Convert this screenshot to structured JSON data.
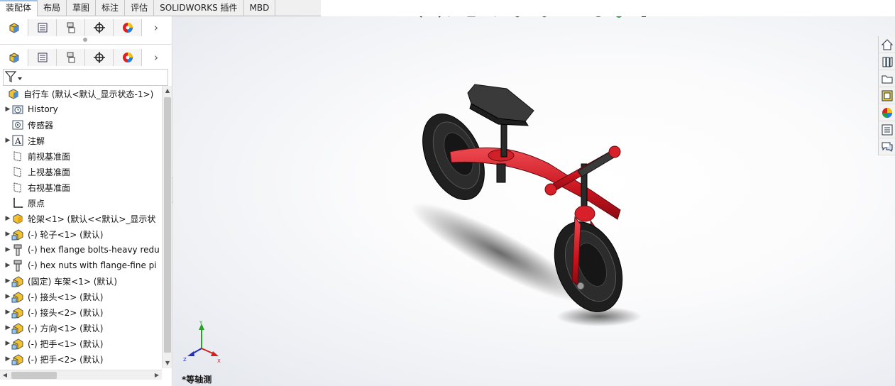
{
  "command_tabs": [
    "装配体",
    "布局",
    "草图",
    "标注",
    "评估",
    "SOLIDWORKS 插件",
    "MBD"
  ],
  "active_command_tab": "装配体",
  "manager_tabs": [
    {
      "name": "featuremanager-tree-icon"
    },
    {
      "name": "propertymanager-icon"
    },
    {
      "name": "configurationmanager-icon"
    },
    {
      "name": "dimxpert-icon"
    },
    {
      "name": "display-manager-icon"
    }
  ],
  "tree": {
    "root_label": "自行车  (默认<默认_显示状态-1>)",
    "items": [
      {
        "label": "History",
        "icon": "history-folder-icon",
        "expandable": true
      },
      {
        "label": "传感器",
        "icon": "sensor-icon",
        "expandable": false
      },
      {
        "label": "注解",
        "icon": "annotation-icon",
        "expandable": true
      },
      {
        "label": "前视基准面",
        "icon": "plane-icon",
        "expandable": false
      },
      {
        "label": "上视基准面",
        "icon": "plane-icon",
        "expandable": false
      },
      {
        "label": "右视基准面",
        "icon": "plane-icon",
        "expandable": false
      },
      {
        "label": "原点",
        "icon": "origin-icon",
        "expandable": false
      },
      {
        "label": "轮架<1> (默认<<默认>_显示状",
        "icon": "subassembly-icon",
        "expandable": true
      },
      {
        "label": "(-) 轮子<1> (默认)",
        "icon": "part-icon",
        "expandable": true
      },
      {
        "label": "(-) hex flange bolts-heavy redu",
        "icon": "bolt-icon",
        "expandable": true
      },
      {
        "label": "(-) hex nuts with flange-fine pi",
        "icon": "bolt-icon",
        "expandable": true
      },
      {
        "label": "(固定) 车架<1> (默认)",
        "icon": "part-icon",
        "expandable": true
      },
      {
        "label": "(-) 接头<1> (默认)",
        "icon": "part-icon",
        "expandable": true
      },
      {
        "label": "(-) 接头<2> (默认)",
        "icon": "part-icon",
        "expandable": true
      },
      {
        "label": "(-) 方向<1> (默认)",
        "icon": "part-icon",
        "expandable": true
      },
      {
        "label": "(-) 把手<1> (默认)",
        "icon": "part-icon",
        "expandable": true
      },
      {
        "label": "(-) 把手<2> (默认)",
        "icon": "part-icon",
        "expandable": true
      }
    ]
  },
  "viewport": {
    "view_name": "*等轴测",
    "triad": {
      "x": "X",
      "y": "Y",
      "z": "Z"
    },
    "colors": {
      "frame": "#c8141e",
      "tire": "#1e1e1e",
      "grip": "#3a3a3a",
      "background": "#eef0f4"
    }
  },
  "hud_tools": [
    "zoom-to-fit-icon",
    "zoom-to-area-icon",
    "previous-view-icon",
    "section-view-icon",
    "dynamic-annotation-icon",
    "view-orientation-icon",
    "display-style-icon",
    "hide-show-items-icon",
    "edit-appearance-icon",
    "apply-scene-icon",
    "view-settings-icon"
  ],
  "task_pane": [
    "home-icon",
    "design-library-icon",
    "file-explorer-icon",
    "view-palette-icon",
    "appearances-icon",
    "custom-properties-icon",
    "forum-icon"
  ]
}
